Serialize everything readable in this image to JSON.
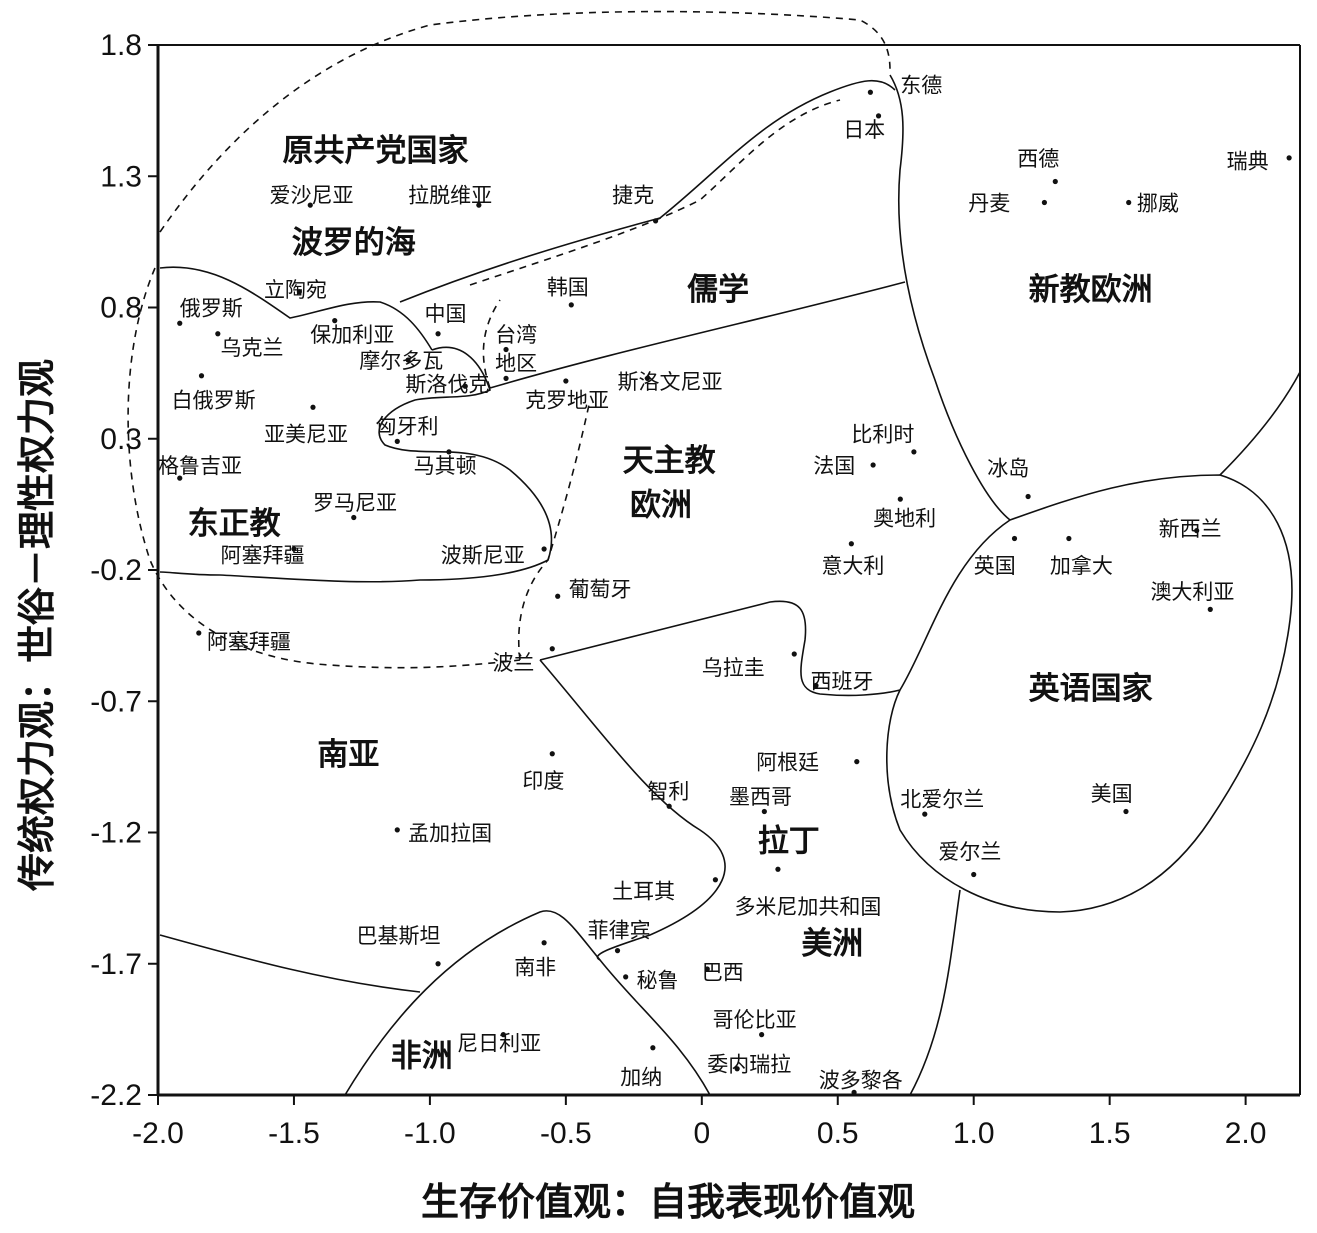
{
  "chart_data": {
    "type": "scatter",
    "xlabel": "生存价值观：自我表现价值观",
    "ylabel": "传统权力观：世俗－理性权力观",
    "xlim": [
      -2.0,
      2.2
    ],
    "ylim": [
      -2.2,
      1.8
    ],
    "x_ticks": [
      {
        "value": -2.0,
        "label": "-2.0"
      },
      {
        "value": -1.5,
        "label": "-1.5"
      },
      {
        "value": -1.0,
        "label": "-1.0"
      },
      {
        "value": -0.5,
        "label": "-0.5"
      },
      {
        "value": 0,
        "label": "0"
      },
      {
        "value": 0.5,
        "label": "0.5"
      },
      {
        "value": 1.0,
        "label": "1.0"
      },
      {
        "value": 1.5,
        "label": "1.5"
      },
      {
        "value": 2.0,
        "label": "2.0"
      }
    ],
    "y_ticks": [
      {
        "value": 1.8,
        "label": "1.8"
      },
      {
        "value": 1.3,
        "label": "1.3"
      },
      {
        "value": 0.8,
        "label": "0.8"
      },
      {
        "value": 0.3,
        "label": "0.3"
      },
      {
        "value": -0.2,
        "label": "-0.2"
      },
      {
        "value": -0.7,
        "label": "-0.7"
      },
      {
        "value": -1.2,
        "label": "-1.2"
      },
      {
        "value": -1.7,
        "label": "-1.7"
      },
      {
        "value": -2.2,
        "label": "-2.2"
      }
    ],
    "grid": false,
    "legend": "none",
    "regions": [
      {
        "name": "原共产党国家",
        "x": -1.2,
        "y": 1.4
      },
      {
        "name": "波罗的海",
        "x": -1.28,
        "y": 1.05
      },
      {
        "name": "儒学",
        "x": 0.06,
        "y": 0.87
      },
      {
        "name": "新教欧洲",
        "x": 1.43,
        "y": 0.87
      },
      {
        "name": "天主教",
        "x": -0.12,
        "y": 0.22
      },
      {
        "name": "欧洲",
        "x": -0.15,
        "y": 0.05
      },
      {
        "name": "东正教",
        "x": -1.72,
        "y": -0.02
      },
      {
        "name": "南亚",
        "x": -1.3,
        "y": -0.9
      },
      {
        "name": "英语国家",
        "x": 1.43,
        "y": -0.65
      },
      {
        "name": "拉丁",
        "x": 0.32,
        "y": -1.23
      },
      {
        "name": "美洲",
        "x": 0.48,
        "y": -1.62
      },
      {
        "name": "非洲",
        "x": -1.03,
        "y": -2.05
      }
    ],
    "points": [
      {
        "name": "东德",
        "x": 0.62,
        "y": 1.62,
        "lx": 0.73,
        "ly": 1.65
      },
      {
        "name": "日本",
        "x": 0.65,
        "y": 1.53,
        "lx": 0.52,
        "ly": 1.48
      },
      {
        "name": "西德",
        "x": 1.3,
        "y": 1.28,
        "lx": 1.16,
        "ly": 1.37
      },
      {
        "name": "瑞典",
        "x": 2.16,
        "y": 1.37,
        "lx": 1.93,
        "ly": 1.36
      },
      {
        "name": "丹麦",
        "x": 1.26,
        "y": 1.2,
        "lx": 0.98,
        "ly": 1.2
      },
      {
        "name": "挪威",
        "x": 1.57,
        "y": 1.2,
        "lx": 1.6,
        "ly": 1.2
      },
      {
        "name": "爱沙尼亚",
        "x": -1.44,
        "y": 1.19,
        "lx": -1.59,
        "ly": 1.23
      },
      {
        "name": "拉脱维亚",
        "x": -0.82,
        "y": 1.19,
        "lx": -1.08,
        "ly": 1.23
      },
      {
        "name": "捷克",
        "x": -0.17,
        "y": 1.13,
        "lx": -0.33,
        "ly": 1.23
      },
      {
        "name": "立陶宛",
        "x": -1.48,
        "y": 0.86,
        "lx": -1.61,
        "ly": 0.87
      },
      {
        "name": "韩国",
        "x": -0.48,
        "y": 0.81,
        "lx": -0.57,
        "ly": 0.88
      },
      {
        "name": "中国",
        "x": -0.97,
        "y": 0.7,
        "lx": -1.02,
        "ly": 0.78
      },
      {
        "name": "俄罗斯",
        "x": -1.92,
        "y": 0.74,
        "lx": -1.92,
        "ly": 0.8
      },
      {
        "name": "保加利亚",
        "x": -1.35,
        "y": 0.75,
        "lx": -1.44,
        "ly": 0.7
      },
      {
        "name": "台湾",
        "x": -0.72,
        "y": 0.64,
        "lx": -0.76,
        "ly": 0.7
      },
      {
        "name": "地区",
        "x": -0.72,
        "y": 0.53,
        "lx": -0.76,
        "ly": 0.59
      },
      {
        "name": "乌克兰",
        "x": -1.78,
        "y": 0.7,
        "lx": -1.77,
        "ly": 0.65
      },
      {
        "name": "摩尔多瓦",
        "x": -1.08,
        "y": 0.6,
        "lx": -1.26,
        "ly": 0.6
      },
      {
        "name": "斯洛伐克",
        "x": -0.87,
        "y": 0.5,
        "lx": -1.09,
        "ly": 0.51
      },
      {
        "name": "斯洛文尼亚",
        "x": -0.2,
        "y": 0.53,
        "lx": -0.31,
        "ly": 0.52
      },
      {
        "name": "白俄罗斯",
        "x": -1.84,
        "y": 0.54,
        "lx": -1.95,
        "ly": 0.45
      },
      {
        "name": "克罗地亚",
        "x": -0.5,
        "y": 0.52,
        "lx": -0.65,
        "ly": 0.45
      },
      {
        "name": "亚美尼亚",
        "x": -1.43,
        "y": 0.42,
        "lx": -1.61,
        "ly": 0.32
      },
      {
        "name": "匈牙利",
        "x": -1.12,
        "y": 0.29,
        "lx": -1.2,
        "ly": 0.35
      },
      {
        "name": "比利时",
        "x": 0.78,
        "y": 0.25,
        "lx": 0.55,
        "ly": 0.32
      },
      {
        "name": "格鲁吉亚",
        "x": -1.92,
        "y": 0.15,
        "lx": -2.0,
        "ly": 0.2
      },
      {
        "name": "马其顿",
        "x": -0.93,
        "y": 0.25,
        "lx": -1.06,
        "ly": 0.2
      },
      {
        "name": "法国",
        "x": 0.63,
        "y": 0.2,
        "lx": 0.41,
        "ly": 0.2
      },
      {
        "name": "冰岛",
        "x": 1.2,
        "y": 0.08,
        "lx": 1.05,
        "ly": 0.19
      },
      {
        "name": "罗马尼亚",
        "x": -1.28,
        "y": 0.0,
        "lx": -1.43,
        "ly": 0.06
      },
      {
        "name": "奥地利",
        "x": 0.73,
        "y": 0.07,
        "lx": 0.63,
        "ly": 0.0
      },
      {
        "name": "新西兰",
        "x": 1.82,
        "y": -0.05,
        "lx": 1.68,
        "ly": -0.04
      },
      {
        "name": "英国",
        "x": 1.15,
        "y": -0.08,
        "lx": 1.0,
        "ly": -0.18
      },
      {
        "name": "加拿大",
        "x": 1.35,
        "y": -0.08,
        "lx": 1.28,
        "ly": -0.18
      },
      {
        "name": "意大利",
        "x": 0.55,
        "y": -0.1,
        "lx": 0.44,
        "ly": -0.18
      },
      {
        "name": "阿塞拜疆",
        "x": -1.5,
        "y": -0.12,
        "lx": -1.77,
        "ly": -0.14
      },
      {
        "name": "波斯尼亚",
        "x": -0.58,
        "y": -0.12,
        "lx": -0.96,
        "ly": -0.14
      },
      {
        "name": "澳大利亚",
        "x": 1.87,
        "y": -0.35,
        "lx": 1.65,
        "ly": -0.28
      },
      {
        "name": "葡萄牙",
        "x": -0.53,
        "y": -0.3,
        "lx": -0.49,
        "ly": -0.27
      },
      {
        "name": "阿塞拜疆",
        "x": -1.85,
        "y": -0.44,
        "lx": -1.82,
        "ly": -0.47
      },
      {
        "name": "波兰",
        "x": -0.55,
        "y": -0.5,
        "lx": -0.77,
        "ly": -0.55
      },
      {
        "name": "乌拉圭",
        "x": 0.34,
        "y": -0.52,
        "lx": 0.0,
        "ly": -0.57
      },
      {
        "name": "西班牙",
        "x": 0.42,
        "y": -0.64,
        "lx": 0.4,
        "ly": -0.62
      },
      {
        "name": "阿根廷",
        "x": 0.57,
        "y": -0.93,
        "lx": 0.2,
        "ly": -0.93
      },
      {
        "name": "印度",
        "x": -0.55,
        "y": -0.9,
        "lx": -0.66,
        "ly": -1.0
      },
      {
        "name": "智利",
        "x": -0.12,
        "y": -1.1,
        "lx": -0.2,
        "ly": -1.04
      },
      {
        "name": "墨西哥",
        "x": 0.23,
        "y": -1.12,
        "lx": 0.1,
        "ly": -1.06
      },
      {
        "name": "北爱尔兰",
        "x": 0.82,
        "y": -1.13,
        "lx": 0.73,
        "ly": -1.07
      },
      {
        "name": "美国",
        "x": 1.56,
        "y": -1.12,
        "lx": 1.43,
        "ly": -1.05
      },
      {
        "name": "孟加拉国",
        "x": -1.12,
        "y": -1.19,
        "lx": -1.08,
        "ly": -1.2
      },
      {
        "name": "爱尔兰",
        "x": 1.0,
        "y": -1.36,
        "lx": 0.87,
        "ly": -1.27
      },
      {
        "name": "土耳其",
        "x": 0.05,
        "y": -1.38,
        "lx": -0.33,
        "ly": -1.42
      },
      {
        "name": "多米尼加共和国",
        "x": 0.28,
        "y": -1.34,
        "lx": 0.12,
        "ly": -1.48
      },
      {
        "name": "巴基斯坦",
        "x": -0.97,
        "y": -1.7,
        "lx": -1.27,
        "ly": -1.59
      },
      {
        "name": "菲律宾",
        "x": -0.31,
        "y": -1.65,
        "lx": -0.42,
        "ly": -1.57
      },
      {
        "name": "南非",
        "x": -0.58,
        "y": -1.62,
        "lx": -0.69,
        "ly": -1.71
      },
      {
        "name": "秘鲁",
        "x": -0.28,
        "y": -1.75,
        "lx": -0.24,
        "ly": -1.76
      },
      {
        "name": "巴西",
        "x": 0.02,
        "y": -1.72,
        "lx": 0.0,
        "ly": -1.73
      },
      {
        "name": "哥伦比亚",
        "x": 0.22,
        "y": -1.97,
        "lx": 0.04,
        "ly": -1.91
      },
      {
        "name": "尼日利亚",
        "x": -0.73,
        "y": -1.97,
        "lx": -0.9,
        "ly": -2.0
      },
      {
        "name": "加纳",
        "x": -0.18,
        "y": -2.02,
        "lx": -0.3,
        "ly": -2.13
      },
      {
        "name": "委内瑞拉",
        "x": 0.13,
        "y": -2.1,
        "lx": 0.02,
        "ly": -2.08
      },
      {
        "name": "波多黎各",
        "x": 0.56,
        "y": -2.19,
        "lx": 0.43,
        "ly": -2.14
      }
    ]
  }
}
